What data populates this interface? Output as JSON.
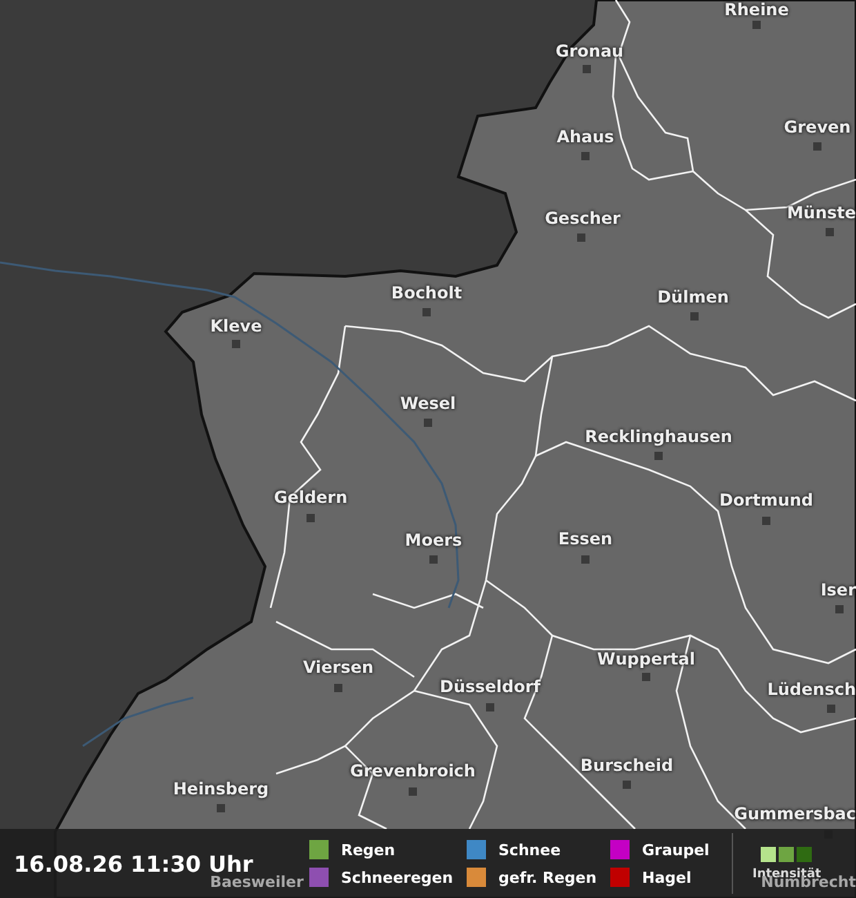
{
  "map": {
    "cities": [
      {
        "name": "Rheine"
      },
      {
        "name": "Gronau"
      },
      {
        "name": "Ahaus"
      },
      {
        "name": "Greven"
      },
      {
        "name": "Gescher"
      },
      {
        "name": "Münste"
      },
      {
        "name": "Bocholt"
      },
      {
        "name": "Dülmen"
      },
      {
        "name": "Kleve"
      },
      {
        "name": "Wesel"
      },
      {
        "name": "Recklinghausen"
      },
      {
        "name": "Geldern"
      },
      {
        "name": "Dortmund"
      },
      {
        "name": "Moers"
      },
      {
        "name": "Essen"
      },
      {
        "name": "Iser"
      },
      {
        "name": "Viersen"
      },
      {
        "name": "Wuppertal"
      },
      {
        "name": "Düsseldorf"
      },
      {
        "name": "Lüdensch"
      },
      {
        "name": "Grevenbroich"
      },
      {
        "name": "Burscheid"
      },
      {
        "name": "Heinsberg"
      },
      {
        "name": "Gummersbac"
      },
      {
        "name": "Baesweiler"
      },
      {
        "name": "Nümbrecht"
      }
    ]
  },
  "legend": {
    "timestamp": "16.08.26 11:30 Uhr",
    "items": [
      {
        "label": "Regen",
        "color": "#6ea542"
      },
      {
        "label": "Schnee",
        "color": "#3f88c5"
      },
      {
        "label": "Graupel",
        "color": "#c400c4"
      },
      {
        "label": "Schneeregen",
        "color": "#8e4fb0"
      },
      {
        "label": "gefr. Regen",
        "color": "#d98a3a"
      },
      {
        "label": "Hagel",
        "color": "#c00000"
      }
    ],
    "intensity": {
      "label": "Intensität",
      "levels": [
        {
          "color": "#b5e38c"
        },
        {
          "color": "#6ea542"
        },
        {
          "color": "#2f6b12"
        }
      ]
    }
  }
}
